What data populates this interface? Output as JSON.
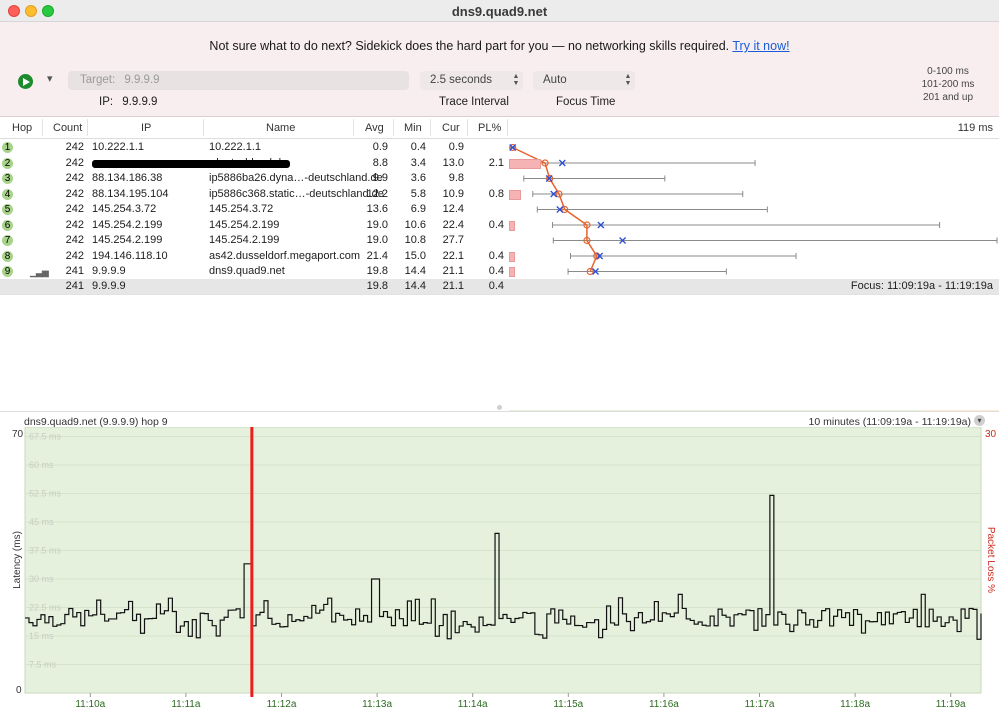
{
  "window": {
    "title": "dns9.quad9.net"
  },
  "promo": {
    "text": "Not sure what to do next? Sidekick does the hard part for you — no networking skills required.",
    "link": "Try it now!"
  },
  "toolbar": {
    "target_label": "Target:",
    "target_value": "9.9.9.9",
    "ip_label": "IP:",
    "ip_value": "9.9.9.9",
    "interval_value": "2.5 seconds",
    "interval_label": "Trace Interval",
    "focus_value": "Auto",
    "focus_label": "Focus Time"
  },
  "legend": [
    {
      "label": "0-100 ms",
      "color": "#a8d38b"
    },
    {
      "label": "101-200 ms",
      "color": "#f5cd6a"
    },
    {
      "label": "201 and up",
      "color": "#f2715f"
    }
  ],
  "table": {
    "headers": [
      "Hop",
      "Count",
      "IP",
      "Name",
      "Avg",
      "Min",
      "Cur",
      "PL%"
    ],
    "graph_max_label": "119 ms",
    "rows": [
      {
        "hop": "1",
        "count": "242",
        "ip": "10.222.1.1",
        "name": "10.222.1.1",
        "avg": "0.9",
        "min": "0.4",
        "cur": "0.9",
        "pl": "",
        "pl_value": 0,
        "avg_ms": 0.9,
        "min_ms": 0.4,
        "cur_ms": 0.9,
        "max_ms": 1.5
      },
      {
        "hop": "2",
        "count": "242",
        "ip": "",
        "name": "-deutschland.de",
        "avg": "8.8",
        "min": "3.4",
        "cur": "13.0",
        "pl": "2.1",
        "pl_value": 2.1,
        "avg_ms": 8.8,
        "min_ms": 3.4,
        "cur_ms": 13.0,
        "max_ms": 60
      },
      {
        "hop": "3",
        "count": "242",
        "ip": "88.134.186.38",
        "name": "ip5886ba26.dyna…-deutschland.de",
        "avg": "9.9",
        "min": "3.6",
        "cur": "9.8",
        "pl": "",
        "pl_value": 0,
        "avg_ms": 9.9,
        "min_ms": 3.6,
        "cur_ms": 9.8,
        "max_ms": 38
      },
      {
        "hop": "4",
        "count": "242",
        "ip": "88.134.195.104",
        "name": "ip5886c368.static…-deutschland.de",
        "avg": "12.2",
        "min": "5.8",
        "cur": "10.9",
        "pl": "0.8",
        "pl_value": 0.8,
        "avg_ms": 12.2,
        "min_ms": 5.8,
        "cur_ms": 10.9,
        "max_ms": 57
      },
      {
        "hop": "5",
        "count": "242",
        "ip": "145.254.3.72",
        "name": "145.254.3.72",
        "avg": "13.6",
        "min": "6.9",
        "cur": "12.4",
        "pl": "",
        "pl_value": 0,
        "avg_ms": 13.6,
        "min_ms": 6.9,
        "cur_ms": 12.4,
        "max_ms": 63
      },
      {
        "hop": "6",
        "count": "242",
        "ip": "145.254.2.199",
        "name": "145.254.2.199",
        "avg": "19.0",
        "min": "10.6",
        "cur": "22.4",
        "pl": "0.4",
        "pl_value": 0.4,
        "avg_ms": 19.0,
        "min_ms": 10.6,
        "cur_ms": 22.4,
        "max_ms": 105
      },
      {
        "hop": "7",
        "count": "242",
        "ip": "145.254.2.199",
        "name": "145.254.2.199",
        "avg": "19.0",
        "min": "10.8",
        "cur": "27.7",
        "pl": "",
        "pl_value": 0,
        "avg_ms": 19.0,
        "min_ms": 10.8,
        "cur_ms": 27.7,
        "max_ms": 119
      },
      {
        "hop": "8",
        "count": "242",
        "ip": "194.146.118.10",
        "name": "as42.dusseldorf.megaport.com",
        "avg": "21.4",
        "min": "15.0",
        "cur": "22.1",
        "pl": "0.4",
        "pl_value": 0.4,
        "avg_ms": 21.4,
        "min_ms": 15.0,
        "cur_ms": 22.1,
        "max_ms": 70
      },
      {
        "hop": "9",
        "count": "241",
        "ip": "9.9.9.9",
        "name": "dns9.quad9.net",
        "avg": "19.8",
        "min": "14.4",
        "cur": "21.1",
        "pl": "0.4",
        "pl_value": 0.4,
        "avg_ms": 19.8,
        "min_ms": 14.4,
        "cur_ms": 21.1,
        "max_ms": 53
      }
    ],
    "summary": {
      "count": "241",
      "ip": "9.9.9.9",
      "avg": "19.8",
      "min": "14.4",
      "cur": "21.1",
      "pl": "0.4",
      "focus": "Focus: 11:09:19a - 11:19:19a"
    }
  },
  "lower_chart": {
    "title": "dns9.quad9.net (9.9.9.9) hop 9",
    "range": "10 minutes (11:09:19a - 11:19:19a)"
  },
  "chart_data": {
    "type": "line",
    "ylabel": "Latency (ms)",
    "y2label": "Packet Loss %",
    "ylim": [
      0,
      70
    ],
    "y2_max_label": "30",
    "y_min_label": "0",
    "y_max_label": "70",
    "y_grid_labels": [
      "7.5 ms",
      "15 ms",
      "22.5 ms",
      "30 ms",
      "37.5 ms",
      "45 ms",
      "52.5 ms",
      "60 ms",
      "67.5 ms"
    ],
    "y_grid_values": [
      7.5,
      15,
      22.5,
      30,
      37.5,
      45,
      52.5,
      60,
      67.5
    ],
    "x_labels": [
      "11:10a",
      "11:11a",
      "11:12a",
      "11:13a",
      "11:14a",
      "11:15a",
      "11:16a",
      "11:17a",
      "11:18a",
      "11:19a"
    ],
    "x_label_minutes": [
      10,
      11,
      12,
      13,
      14,
      15,
      16,
      17,
      18,
      19
    ],
    "x_range_minutes": [
      9.317,
      19.317
    ],
    "packet_loss_marker_minute": 11.69,
    "spikes": [
      {
        "minute": 11.63,
        "value": 34
      },
      {
        "minute": 12.96,
        "value": 30
      },
      {
        "minute": 14.23,
        "value": 42
      },
      {
        "minute": 17.1,
        "value": 52
      },
      {
        "minute": 19.25,
        "value": 22
      }
    ],
    "baseline": 19.8
  }
}
